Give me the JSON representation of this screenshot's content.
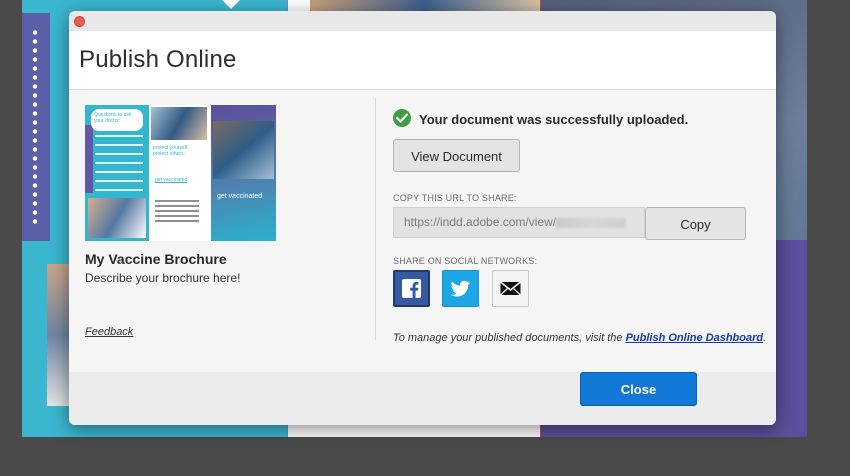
{
  "dialog": {
    "title": "Publish Online"
  },
  "document": {
    "name": "My Vaccine Brochure",
    "description": "Describe your brochure here!",
    "thumbnail": {
      "panel1_heading": "Questions to ask your doctor:",
      "panel2_text": "protect yourself. protect others.",
      "panel2_link": "get vaccinated",
      "panel3_text": "get vaccinated"
    }
  },
  "feedback": {
    "label": "Feedback"
  },
  "status": {
    "message": "Your document was successfully uploaded.",
    "icon": "checkmark-circle-icon",
    "color": "#3b9e43"
  },
  "actions": {
    "view_document_label": "View Document",
    "copy_label": "Copy",
    "close_label": "Close"
  },
  "share_url": {
    "label": "COPY THIS URL TO SHARE:",
    "value": "https://indd.adobe.com/view/"
  },
  "social": {
    "label": "SHARE ON SOCIAL NETWORKS:",
    "networks": [
      {
        "name": "Facebook",
        "icon": "facebook-icon",
        "color": "#355aa0"
      },
      {
        "name": "Twitter",
        "icon": "twitter-icon",
        "color": "#1da6e6"
      },
      {
        "name": "Email",
        "icon": "email-icon",
        "color": "#f4f4f4"
      }
    ]
  },
  "manage": {
    "text": "To manage your published documents, visit the ",
    "link_label": "Publish Online Dashboard",
    "suffix": "."
  },
  "colors": {
    "primary_button": "#1278d8",
    "link": "#1437b5",
    "close_traffic_light": "#ec5a52"
  }
}
